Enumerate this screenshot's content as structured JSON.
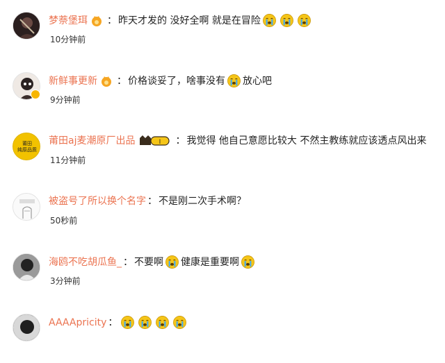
{
  "comments": [
    {
      "username": "梦萘堡珥",
      "colon": "：",
      "text_parts": [
        "昨天才发的 没好全啊 就是在冒险"
      ],
      "time": "10分钟前"
    },
    {
      "username": "新鲜事更新",
      "colon": "：",
      "text_parts": [
        "价格谈妥了，啥事没有",
        "放心吧"
      ],
      "time": "9分钟前"
    },
    {
      "username": "莆田aj麦潮原厂出品",
      "colon": "：",
      "text_parts": [
        "我觉得 他自己意愿比较大 不然主教练就应该透点风出来"
      ],
      "time": "11分钟前"
    },
    {
      "username": "被盗号了所以换个名字",
      "colon": "：",
      "text_parts": [
        "不是刚二次手术啊？"
      ],
      "time": "50秒前"
    },
    {
      "username": "海鸥不吃胡瓜鱼_",
      "colon": "：",
      "text_parts": [
        "不要啊",
        "健康是重要啊"
      ],
      "time": "3分钟前"
    },
    {
      "username": "AAAApricity",
      "colon": "：",
      "text_parts": [],
      "time": ""
    }
  ],
  "avatar_text": {
    "line1": "莆田",
    "line2": "纯原品质"
  },
  "badge": {
    "vip_label": "I"
  },
  "icons": {
    "crying": "crying-emoji-icon",
    "crown": "crown-icon",
    "vip": "vip-level-badge-icon",
    "verified": "verified-badge-icon"
  },
  "colors": {
    "username": "#eb7350",
    "text": "#222222",
    "emoji": "#f5c518",
    "tears": "#3fa9f5"
  }
}
